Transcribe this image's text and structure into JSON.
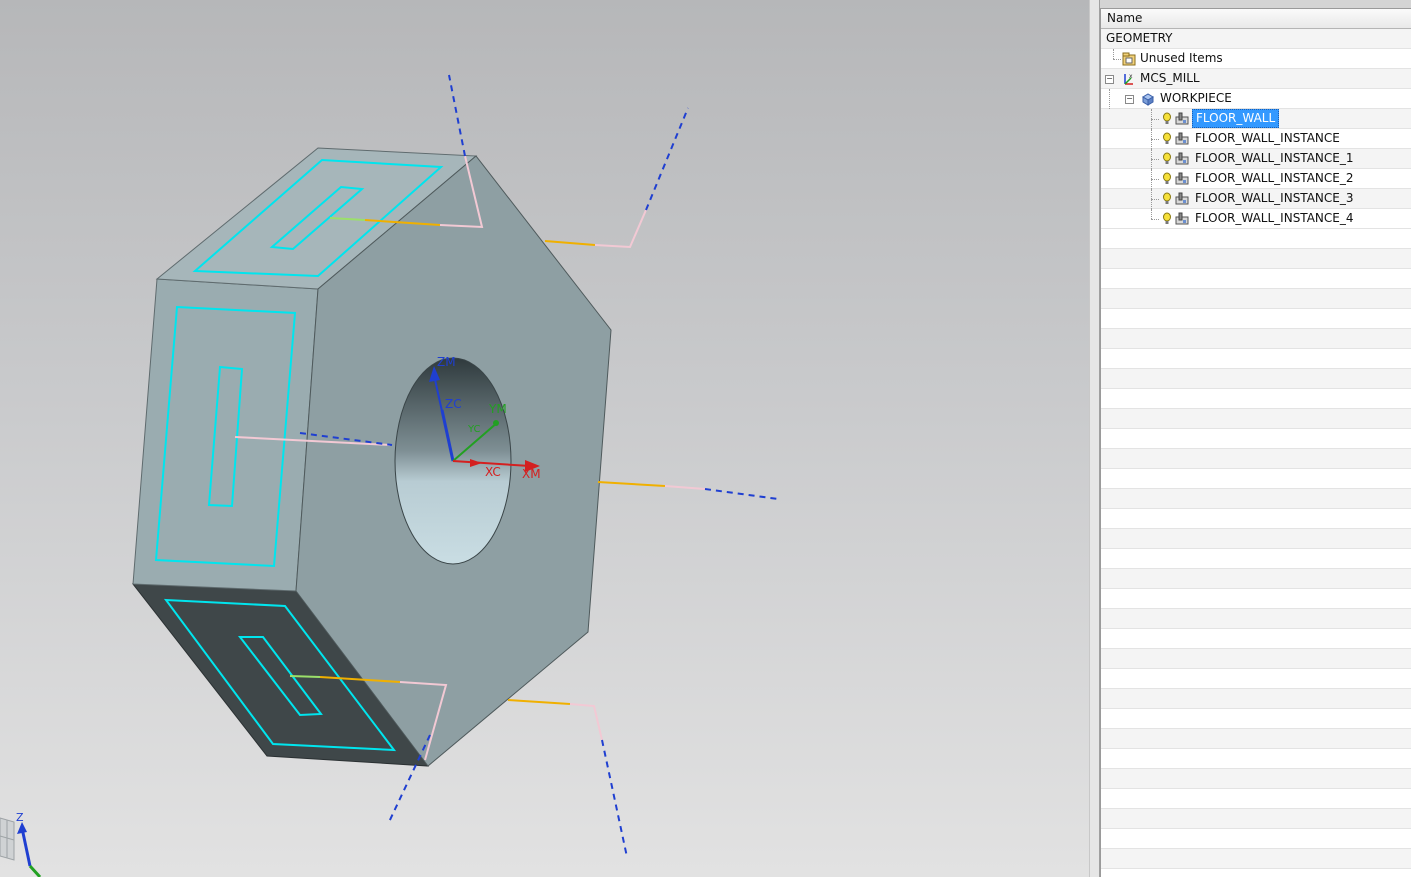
{
  "viewport": {
    "axis_labels": {
      "zm": "ZM",
      "zc": "ZC",
      "ym": "YM",
      "yc": "YC",
      "xc": "XC",
      "xm": "XM",
      "triad_z": "Z"
    },
    "colors": {
      "body_face": "#8e9fa3",
      "top_face": "#a6b6ba",
      "side_face": "#9aacb0",
      "bottom_face": "#3f4749",
      "outline": "#00e5ee",
      "tool_axis": "#1f3fd1",
      "feed_yellow": "#f0b000",
      "feed_pink": "#f2c9d4"
    }
  },
  "navigator": {
    "column_header": "Name",
    "root": "GEOMETRY",
    "items": [
      {
        "label": "Unused Items",
        "icon": "folder-icon"
      },
      {
        "label": "MCS_MILL",
        "icon": "mcs-icon"
      },
      {
        "label": "WORKPIECE",
        "icon": "workpiece-icon"
      },
      {
        "label": "FLOOR_WALL",
        "icon": "operation-icon",
        "selected": true
      },
      {
        "label": "FLOOR_WALL_INSTANCE",
        "icon": "operation-icon"
      },
      {
        "label": "FLOOR_WALL_INSTANCE_1",
        "icon": "operation-icon"
      },
      {
        "label": "FLOOR_WALL_INSTANCE_2",
        "icon": "operation-icon"
      },
      {
        "label": "FLOOR_WALL_INSTANCE_3",
        "icon": "operation-icon"
      },
      {
        "label": "FLOOR_WALL_INSTANCE_4",
        "icon": "operation-icon"
      }
    ],
    "selection_color": "#3399ff"
  }
}
